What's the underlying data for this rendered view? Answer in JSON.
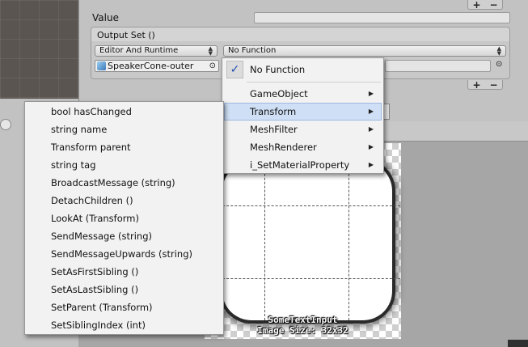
{
  "inspector": {
    "value_label": "Value",
    "plus": "+",
    "minus": "−",
    "output_set_title": "Output Set ()",
    "mode_popup": "Editor And Runtime",
    "function_popup": "No Function",
    "object_field": "SpeakerCone-outer",
    "object_picker": "⊙"
  },
  "function_menu": {
    "items": [
      {
        "label": "No Function",
        "checked": true,
        "has_submenu": false
      },
      {
        "label": "GameObject",
        "has_submenu": true
      },
      {
        "label": "Transform",
        "has_submenu": true,
        "highlighted": true
      },
      {
        "label": "MeshFilter",
        "has_submenu": true
      },
      {
        "label": "MeshRenderer",
        "has_submenu": true
      },
      {
        "label": "i_SetMaterialProperty",
        "has_submenu": true
      }
    ],
    "checkmark": "✓",
    "submenu_arrow": "▶"
  },
  "transform_menu": {
    "items": [
      "bool hasChanged",
      "string name",
      "Transform parent",
      "string tag",
      "BroadcastMessage (string)",
      "DetachChildren ()",
      "LookAt (Transform)",
      "SendMessage (string)",
      "SendMessageUpwards (string)",
      "SetAsFirstSibling ()",
      "SetAsLastSibling ()",
      "SetParent (Transform)",
      "SetSiblingIndex (int)"
    ]
  },
  "preview": {
    "name": "SomeTextInput",
    "size_text": "Image Size: 32x32"
  }
}
